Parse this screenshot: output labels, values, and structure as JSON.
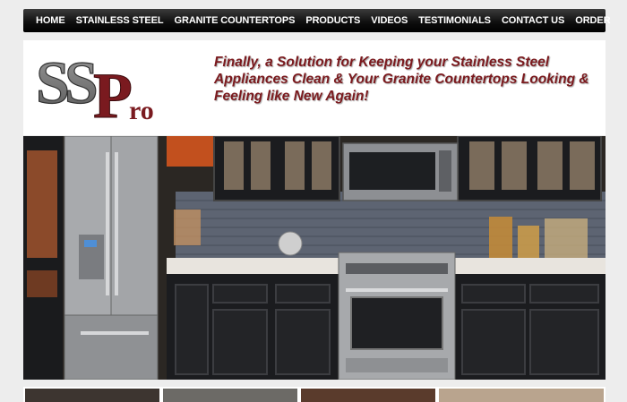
{
  "nav": {
    "items": [
      "HOME",
      "STAINLESS STEEL",
      "GRANITE COUNTERTOPS",
      "PRODUCTS",
      "VIDEOS",
      "TESTIMONIALS",
      "CONTACT US",
      "ORDER"
    ]
  },
  "logo": {
    "text_main": "SS",
    "text_p": "P",
    "text_ro": "ro"
  },
  "tagline": "Finally, a Solution for Keeping your Stainless Steel Appliances Clean & Your Granite Countertops Looking & Feeling like New Again!",
  "colors": {
    "tagline": "#7b1a1e",
    "logo_gray": "#6d6d6d",
    "logo_maroon": "#7a1a1f",
    "nav_bg": "#111111"
  },
  "hero": {
    "image": "kitchen-photo"
  }
}
